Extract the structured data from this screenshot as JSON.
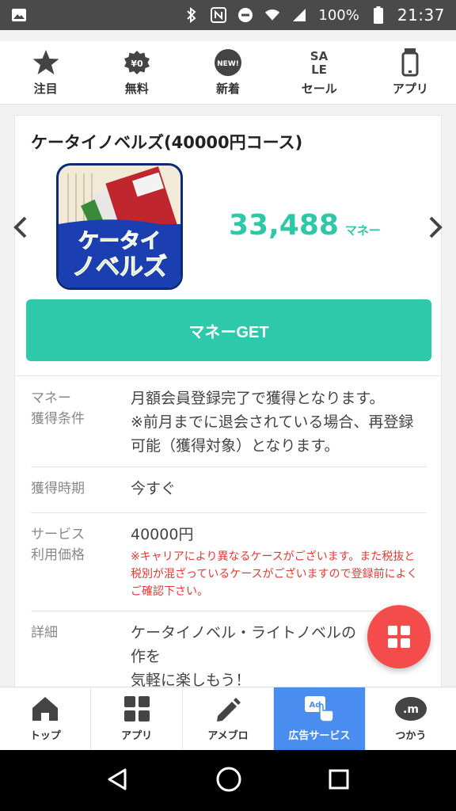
{
  "status_bar": {
    "battery": "100%",
    "time": "21:37"
  },
  "top_nav": [
    {
      "label": "注目",
      "icon": "star-icon"
    },
    {
      "label": "無料",
      "icon": "free-yen-badge-icon",
      "badge": "¥0"
    },
    {
      "label": "新着",
      "icon": "new-badge-icon",
      "badge": "NEW!"
    },
    {
      "label": "セール",
      "icon": "sale-icon",
      "badge": "SALE"
    },
    {
      "label": "アプリ",
      "icon": "phone-app-icon"
    }
  ],
  "offer": {
    "title": "ケータイノベルズ(40000円コース)",
    "app_icon_text_1": "ケータイ",
    "app_icon_text_2": "ノベルズ",
    "reward_amount": "33,488",
    "reward_unit": "マネー",
    "get_button": "マネーGET"
  },
  "details": [
    {
      "key": "マネー\n獲得条件",
      "value": "月額会員登録完了で獲得となります。\n※前月までに退会されている場合、再登録可能（獲得対象）となります。"
    },
    {
      "key": "獲得時期",
      "value": "今すぐ"
    },
    {
      "key": "サービス\n利用価格",
      "value": "40000円",
      "note": "※キャリアにより異なるケースがございます。また税抜と税別が混ざっているケースがございますので登録前によくご確認下さい。"
    },
    {
      "key": "詳細",
      "value": "ケータイノベル・ライトノベルの\n作を\n気軽に楽しもう！"
    }
  ],
  "bottom_tabs": [
    {
      "label": "トップ",
      "icon": "home-icon",
      "active": false
    },
    {
      "label": "アプリ",
      "icon": "apps-grid-icon",
      "active": false
    },
    {
      "label": "アメブロ",
      "icon": "pencil-icon",
      "active": false
    },
    {
      "label": "広告サービス",
      "icon": "ad-touch-icon",
      "active": true,
      "badge": "Ad"
    },
    {
      "label": "つかう",
      "icon": "money-coin-icon",
      "badge": ".m"
    }
  ],
  "colors": {
    "accent": "#2ec9aa",
    "fab": "#f44b4b",
    "active_tab": "#4a8df0",
    "warning": "#e53935"
  }
}
